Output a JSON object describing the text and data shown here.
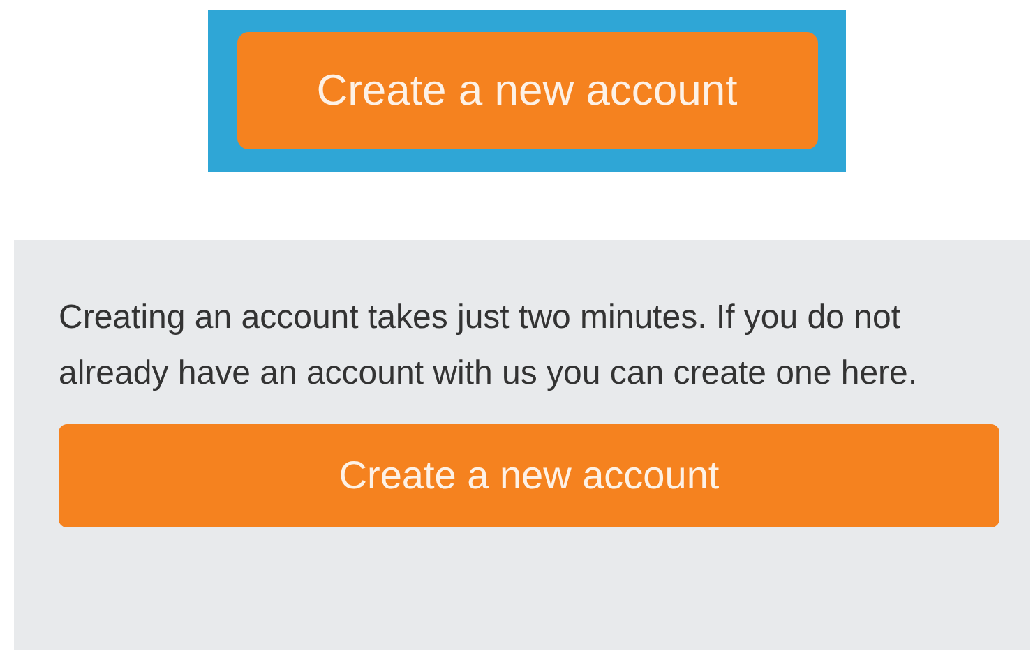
{
  "banner": {
    "button": "Create a new account"
  },
  "panel": {
    "text": "Creating an account takes just two minutes. If you do not already have an account with us you can create one here.",
    "button": "Create a new account"
  }
}
